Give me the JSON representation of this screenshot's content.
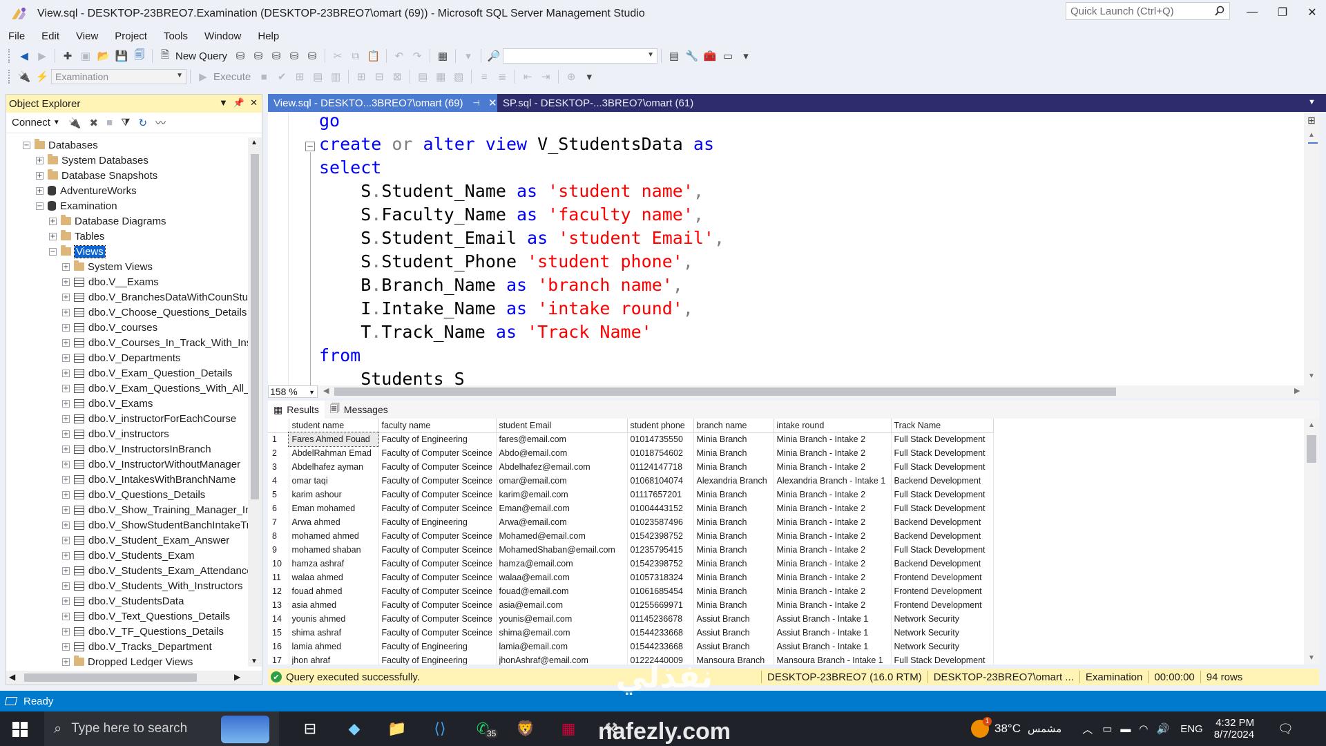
{
  "window": {
    "title": "View.sql - DESKTOP-23BREO7.Examination (DESKTOP-23BREO7\\omart (69)) - Microsoft SQL Server Management Studio",
    "quick_launch_placeholder": "Quick Launch (Ctrl+Q)",
    "controls": {
      "minimize": "—",
      "restore": "❐",
      "close": "✕"
    }
  },
  "menu": [
    "File",
    "Edit",
    "View",
    "Project",
    "Tools",
    "Window",
    "Help"
  ],
  "toolbar": {
    "new_query": "New Query",
    "execute": "Execute",
    "database_combo": "Examination"
  },
  "object_explorer": {
    "title": "Object Explorer",
    "connect_label": "Connect",
    "tree": [
      {
        "label": "Databases",
        "level": 0,
        "icon": "folder-icon",
        "expanded": true
      },
      {
        "label": "System Databases",
        "level": 1,
        "icon": "folder-icon",
        "expanded": false
      },
      {
        "label": "Database Snapshots",
        "level": 1,
        "icon": "folder-icon",
        "expanded": false
      },
      {
        "label": "AdventureWorks",
        "level": 1,
        "icon": "database-icon",
        "expanded": false
      },
      {
        "label": "Examination",
        "level": 1,
        "icon": "database-icon",
        "expanded": true
      },
      {
        "label": "Database Diagrams",
        "level": 2,
        "icon": "folder-icon",
        "expanded": false
      },
      {
        "label": "Tables",
        "level": 2,
        "icon": "folder-icon",
        "expanded": false
      },
      {
        "label": "Views",
        "level": 2,
        "icon": "folder-icon",
        "expanded": true,
        "selected": true
      },
      {
        "label": "System Views",
        "level": 3,
        "icon": "folder-icon",
        "expanded": false
      },
      {
        "label": "dbo.V__Exams",
        "level": 3,
        "icon": "view-icon",
        "expanded": false
      },
      {
        "label": "dbo.V_BranchesDataWithCounStu",
        "level": 3,
        "icon": "view-icon",
        "expanded": false
      },
      {
        "label": "dbo.V_Choose_Questions_Details",
        "level": 3,
        "icon": "view-icon",
        "expanded": false
      },
      {
        "label": "dbo.V_courses",
        "level": 3,
        "icon": "view-icon",
        "expanded": false
      },
      {
        "label": "dbo.V_Courses_In_Track_With_Instr",
        "level": 3,
        "icon": "view-icon",
        "expanded": false
      },
      {
        "label": "dbo.V_Departments",
        "level": 3,
        "icon": "view-icon",
        "expanded": false
      },
      {
        "label": "dbo.V_Exam_Question_Details",
        "level": 3,
        "icon": "view-icon",
        "expanded": false
      },
      {
        "label": "dbo.V_Exam_Questions_With_All_D",
        "level": 3,
        "icon": "view-icon",
        "expanded": false
      },
      {
        "label": "dbo.V_Exams",
        "level": 3,
        "icon": "view-icon",
        "expanded": false
      },
      {
        "label": "dbo.V_instructorForEachCourse",
        "level": 3,
        "icon": "view-icon",
        "expanded": false
      },
      {
        "label": "dbo.V_instructors",
        "level": 3,
        "icon": "view-icon",
        "expanded": false
      },
      {
        "label": "dbo.V_InstructorsInBranch",
        "level": 3,
        "icon": "view-icon",
        "expanded": false
      },
      {
        "label": "dbo.V_InstructorWithoutManager",
        "level": 3,
        "icon": "view-icon",
        "expanded": false
      },
      {
        "label": "dbo.V_IntakesWithBranchName",
        "level": 3,
        "icon": "view-icon",
        "expanded": false
      },
      {
        "label": "dbo.V_Questions_Details",
        "level": 3,
        "icon": "view-icon",
        "expanded": false
      },
      {
        "label": "dbo.V_Show_Training_Manager_In",
        "level": 3,
        "icon": "view-icon",
        "expanded": false
      },
      {
        "label": "dbo.V_ShowStudentBanchIntakeTr",
        "level": 3,
        "icon": "view-icon",
        "expanded": false
      },
      {
        "label": "dbo.V_Student_Exam_Answer",
        "level": 3,
        "icon": "view-icon",
        "expanded": false
      },
      {
        "label": "dbo.V_Students_Exam",
        "level": 3,
        "icon": "view-icon",
        "expanded": false
      },
      {
        "label": "dbo.V_Students_Exam_Attendance",
        "level": 3,
        "icon": "view-icon",
        "expanded": false
      },
      {
        "label": "dbo.V_Students_With_Instructors",
        "level": 3,
        "icon": "view-icon",
        "expanded": false
      },
      {
        "label": "dbo.V_StudentsData",
        "level": 3,
        "icon": "view-icon",
        "expanded": false
      },
      {
        "label": "dbo.V_Text_Questions_Details",
        "level": 3,
        "icon": "view-icon",
        "expanded": false
      },
      {
        "label": "dbo.V_TF_Questions_Details",
        "level": 3,
        "icon": "view-icon",
        "expanded": false
      },
      {
        "label": "dbo.V_Tracks_Department",
        "level": 3,
        "icon": "view-icon",
        "expanded": false
      },
      {
        "label": "Dropped Ledger Views",
        "level": 3,
        "icon": "folder-icon",
        "expanded": false
      }
    ]
  },
  "document_tabs": [
    {
      "label": "View.sql - DESKTO...3BREO7\\omart (69)",
      "active": true
    },
    {
      "label": "SP.sql - DESKTOP-...3BREO7\\omart (61)",
      "active": false
    }
  ],
  "editor": {
    "zoom": "158 %",
    "lines": [
      [
        {
          "t": "go",
          "c": "kw"
        }
      ],
      [
        {
          "t": "create",
          "c": "kw"
        },
        {
          "t": " ",
          "c": "id"
        },
        {
          "t": "or",
          "c": "gr"
        },
        {
          "t": " ",
          "c": "id"
        },
        {
          "t": "alter",
          "c": "kw"
        },
        {
          "t": " ",
          "c": "id"
        },
        {
          "t": "view",
          "c": "kw"
        },
        {
          "t": " V_StudentsData ",
          "c": "id"
        },
        {
          "t": "as",
          "c": "kw"
        }
      ],
      [
        {
          "t": "select",
          "c": "kw"
        }
      ],
      [
        {
          "t": "    S",
          "c": "id"
        },
        {
          "t": ".",
          "c": "gr"
        },
        {
          "t": "Student_Name ",
          "c": "id"
        },
        {
          "t": "as",
          "c": "kw"
        },
        {
          "t": " ",
          "c": "id"
        },
        {
          "t": "'student name'",
          "c": "str"
        },
        {
          "t": ",",
          "c": "gr"
        }
      ],
      [
        {
          "t": "    S",
          "c": "id"
        },
        {
          "t": ".",
          "c": "gr"
        },
        {
          "t": "Faculty_Name ",
          "c": "id"
        },
        {
          "t": "as",
          "c": "kw"
        },
        {
          "t": " ",
          "c": "id"
        },
        {
          "t": "'faculty name'",
          "c": "str"
        },
        {
          "t": ",",
          "c": "gr"
        }
      ],
      [
        {
          "t": "    S",
          "c": "id"
        },
        {
          "t": ".",
          "c": "gr"
        },
        {
          "t": "Student_Email ",
          "c": "id"
        },
        {
          "t": "as",
          "c": "kw"
        },
        {
          "t": " ",
          "c": "id"
        },
        {
          "t": "'student Email'",
          "c": "str"
        },
        {
          "t": ",",
          "c": "gr"
        }
      ],
      [
        {
          "t": "    S",
          "c": "id"
        },
        {
          "t": ".",
          "c": "gr"
        },
        {
          "t": "Student_Phone ",
          "c": "id"
        },
        {
          "t": "'student phone'",
          "c": "str"
        },
        {
          "t": ",",
          "c": "gr"
        }
      ],
      [
        {
          "t": "    B",
          "c": "id"
        },
        {
          "t": ".",
          "c": "gr"
        },
        {
          "t": "Branch_Name ",
          "c": "id"
        },
        {
          "t": "as",
          "c": "kw"
        },
        {
          "t": " ",
          "c": "id"
        },
        {
          "t": "'branch name'",
          "c": "str"
        },
        {
          "t": ",",
          "c": "gr"
        }
      ],
      [
        {
          "t": "    I",
          "c": "id"
        },
        {
          "t": ".",
          "c": "gr"
        },
        {
          "t": "Intake_Name ",
          "c": "id"
        },
        {
          "t": "as",
          "c": "kw"
        },
        {
          "t": " ",
          "c": "id"
        },
        {
          "t": "'intake round'",
          "c": "str"
        },
        {
          "t": ",",
          "c": "gr"
        }
      ],
      [
        {
          "t": "    T",
          "c": "id"
        },
        {
          "t": ".",
          "c": "gr"
        },
        {
          "t": "Track_Name ",
          "c": "id"
        },
        {
          "t": "as",
          "c": "kw"
        },
        {
          "t": " ",
          "c": "id"
        },
        {
          "t": "'Track Name'",
          "c": "str"
        }
      ],
      [
        {
          "t": "from",
          "c": "kw"
        }
      ],
      [
        {
          "t": "    Students S",
          "c": "id"
        }
      ]
    ]
  },
  "results": {
    "tabs": [
      "Results",
      "Messages"
    ],
    "columns": [
      "student name",
      "faculty name",
      "student Email",
      "student phone",
      "branch name",
      "intake round",
      "Track Name"
    ],
    "rows": [
      [
        "Fares Ahmed Fouad",
        "Faculty of Engineering",
        "fares@email.com",
        "01014735550",
        "Minia Branch",
        "Minia Branch - Intake 2",
        "Full Stack Development"
      ],
      [
        "AbdelRahman Emad",
        "Faculty of Computer Sceince",
        "Abdo@email.com",
        "01018754602",
        "Minia Branch",
        "Minia Branch - Intake 2",
        "Full Stack Development"
      ],
      [
        "Abdelhafez ayman",
        "Faculty of Computer Sceince",
        "Abdelhafez@email.com",
        "01124147718",
        "Minia Branch",
        "Minia Branch - Intake 2",
        "Full Stack Development"
      ],
      [
        "omar taqi",
        "Faculty of Computer Sceince",
        "omar@email.com",
        "01068104074",
        "Alexandria Branch",
        "Alexandria Branch - Intake 1",
        "Backend Development"
      ],
      [
        "karim ashour",
        "Faculty of Computer Sceince",
        "karim@email.com",
        "01117657201",
        "Minia Branch",
        "Minia Branch - Intake 2",
        "Full Stack Development"
      ],
      [
        "Eman mohamed",
        "Faculty of Computer Sceince",
        "Eman@email.com",
        "01004443152",
        "Minia Branch",
        "Minia Branch - Intake 2",
        "Full Stack Development"
      ],
      [
        "Arwa ahmed",
        "Faculty of Engineering",
        "Arwa@email.com",
        "01023587496",
        "Minia Branch",
        "Minia Branch - Intake 2",
        "Backend Development"
      ],
      [
        "mohamed ahmed",
        "Faculty of Computer Sceince",
        "Mohamed@email.com",
        "01542398752",
        "Minia Branch",
        "Minia Branch - Intake 2",
        "Backend Development"
      ],
      [
        "mohamed shaban",
        "Faculty of Computer Sceince",
        "MohamedShaban@email.com",
        "01235795415",
        "Minia Branch",
        "Minia Branch - Intake 2",
        "Full Stack Development"
      ],
      [
        "hamza ashraf",
        "Faculty of Computer Sceince",
        "hamza@email.com",
        "01542398752",
        "Minia Branch",
        "Minia Branch - Intake 2",
        "Backend Development"
      ],
      [
        "walaa ahmed",
        "Faculty of Computer Sceince",
        "walaa@email.com",
        "01057318324",
        "Minia Branch",
        "Minia Branch - Intake 2",
        "Frontend Development"
      ],
      [
        "fouad ahmed",
        "Faculty of Computer Sceince",
        "fouad@email.com",
        "01061685454",
        "Minia Branch",
        "Minia Branch - Intake 2",
        "Frontend Development"
      ],
      [
        "asia ahmed",
        "Faculty of Computer Sceince",
        "asia@email.com",
        "01255669971",
        "Minia Branch",
        "Minia Branch - Intake 2",
        "Frontend Development"
      ],
      [
        "younis ahmed",
        "Faculty of Computer Sceince",
        "younis@email.com",
        "01145236678",
        "Assiut Branch",
        "Assiut Branch - Intake 1",
        "Network Security"
      ],
      [
        "shima ashraf",
        "Faculty of Computer Sceince",
        "shima@email.com",
        "01544233668",
        "Assiut Branch",
        "Assiut Branch - Intake 1",
        "Network Security"
      ],
      [
        "lamia ahmed",
        "Faculty of Engineering",
        "lamia@email.com",
        "01544233668",
        "Assiut Branch",
        "Assiut Branch - Intake 1",
        "Network Security"
      ],
      [
        "jhon ahraf",
        "Faculty of Engineering",
        "jhonAshraf@email.com",
        "01222440009",
        "Mansoura Branch",
        "Mansoura Branch - Intake 1",
        "Full Stack Development"
      ]
    ]
  },
  "query_status": {
    "message": "Query executed successfully.",
    "server": "DESKTOP-23BREO7 (16.0 RTM)",
    "user": "DESKTOP-23BREO7\\omart ...",
    "database": "Examination",
    "elapsed": "00:00:00",
    "rows": "94 rows"
  },
  "status_bar": {
    "ready": "Ready"
  },
  "taskbar": {
    "search_placeholder": "Type here to search",
    "whatsapp_badge": "35",
    "weather": "38°C",
    "weather_desc": "مشمس",
    "language": "ENG",
    "time": "4:32 PM",
    "date": "8/7/2024",
    "weather_badge": "1"
  },
  "watermark": {
    "arabic": "نفذلي",
    "latin": "nafezly.com"
  },
  "colors": {
    "accent": "#007acc",
    "tab_active": "#4b7ad1",
    "tab_bar": "#2d2d6e",
    "keyword": "#0000ff",
    "string": "#ff0000",
    "selection": "#0a64d6",
    "status_yellow": "#fff3b5"
  }
}
